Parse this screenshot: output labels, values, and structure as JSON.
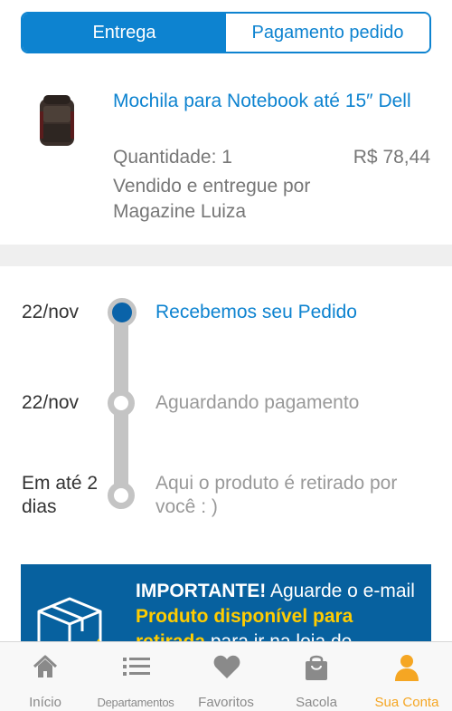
{
  "tabs": [
    {
      "label": "Entrega",
      "active": true
    },
    {
      "label": "Pagamento pedido",
      "active": false
    }
  ],
  "product": {
    "name": "Mochila para Notebook até 15″ Dell",
    "quantity": "Quantidade: 1",
    "price": "R$ 78,44",
    "seller": "Vendido e entregue por Magazine Luiza"
  },
  "timeline": [
    {
      "date": "22/nov",
      "label": "Recebemos seu Pedido",
      "status": "done"
    },
    {
      "date": "22/nov",
      "label": "Aguardando pagamento",
      "status": "pending"
    },
    {
      "date": "Em até 2 dias",
      "label": "Aqui o produto é retirado por você : )",
      "status": "pending"
    }
  ],
  "banner": {
    "important": "IMPORTANTE!",
    "text_before": " Aguarde o e-mail ",
    "highlight": "Produto disponível para retirada",
    "text_after": " para ir na loja de"
  },
  "bottom_nav": [
    {
      "label": "Início",
      "icon": "home-icon",
      "active": false
    },
    {
      "label": "Departamentos",
      "icon": "list-icon",
      "active": false
    },
    {
      "label": "Favoritos",
      "icon": "heart-icon",
      "active": false
    },
    {
      "label": "Sacola",
      "icon": "bag-icon",
      "active": false
    },
    {
      "label": "Sua Conta",
      "icon": "user-icon",
      "active": true
    }
  ],
  "colors": {
    "brand_blue": "#0d83d0",
    "dark_blue": "#07619f",
    "active_nav": "#f5a623",
    "highlight": "#ffcc00"
  }
}
